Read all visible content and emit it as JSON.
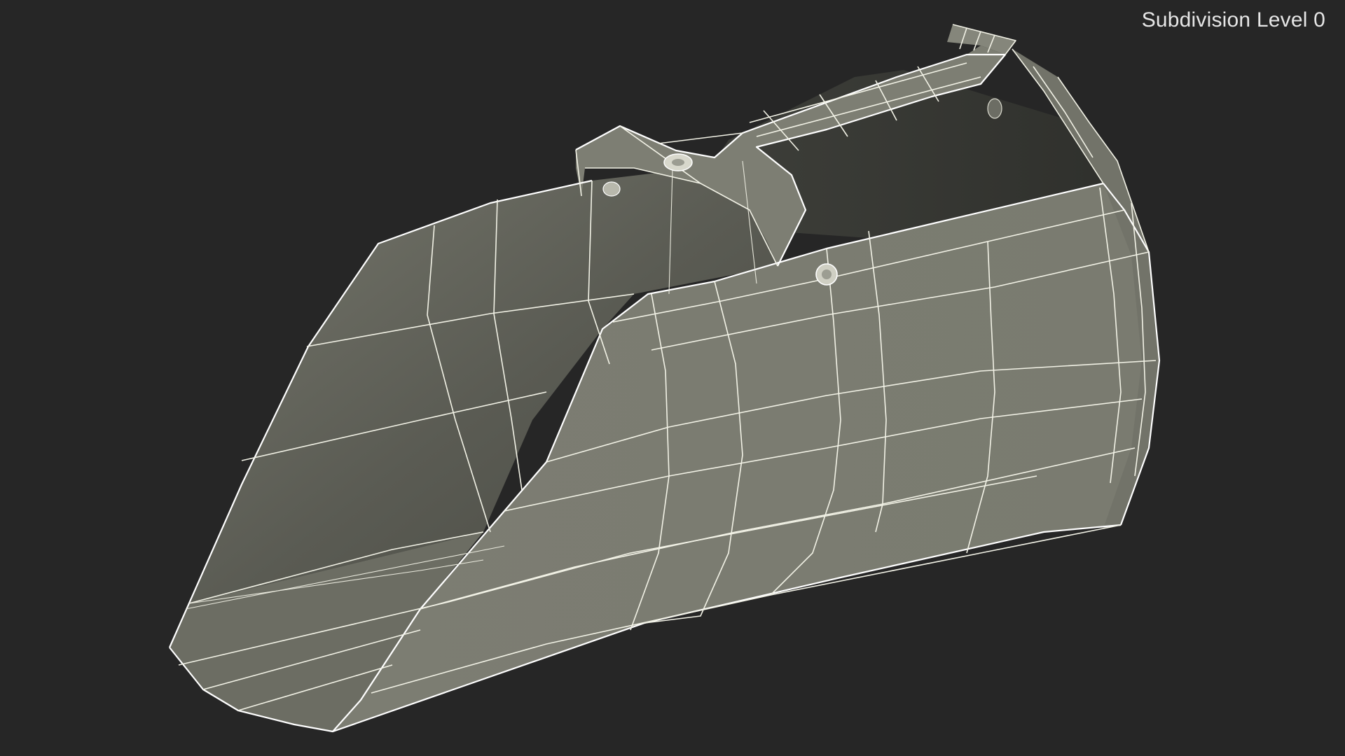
{
  "viewport": {
    "overlay_label": "Subdivision Level 0"
  },
  "model": {
    "object": "scoop",
    "display": "wireframe-on-shaded",
    "colors": {
      "background": "#262626",
      "outer_surface": "#7a7b70",
      "inner_surface": "#5c5d55",
      "wireframe": "#f2f2e6"
    }
  }
}
